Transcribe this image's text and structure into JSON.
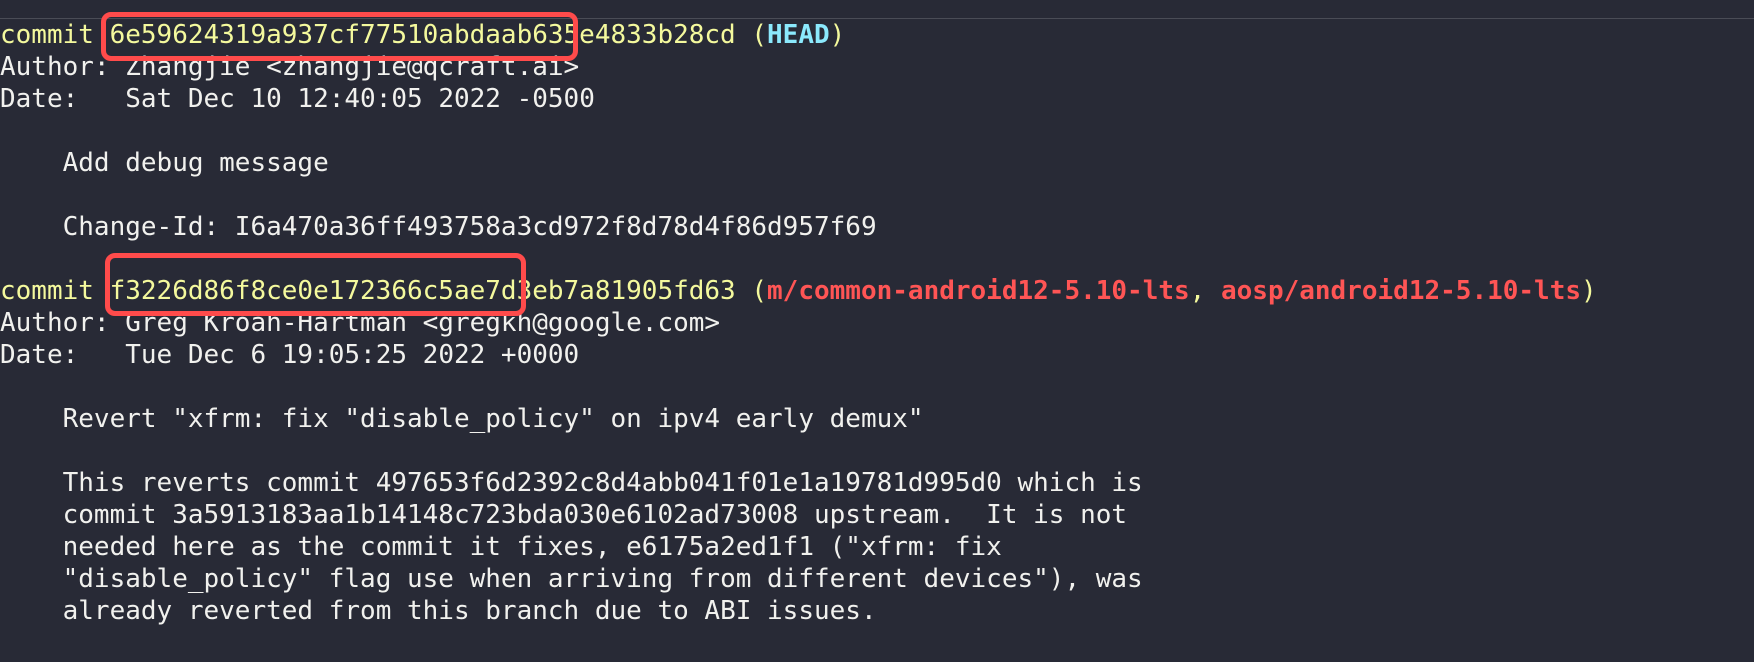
{
  "log": {
    "commit1": {
      "keyword": "commit",
      "hash": "6e59624319a937cf77510abdaab635e4833b28cd",
      "refs_open": "(",
      "ref_head": "HEAD",
      "refs_close": ")",
      "author_label": "Author:",
      "author_value": "Zhangjie <zhangjie@qcraft.ai>",
      "date_label": "Date:",
      "date_value": "Sat Dec 10 12:40:05 2022 -0500",
      "message_title": "Add debug message",
      "change_id": "Change-Id: I6a470a36ff493758a3cd972f8d78d4f86d957f69"
    },
    "commit2": {
      "keyword": "commit",
      "hash": "f3226d86f8ce0e172366c5ae7d3eb7a81905fd63",
      "refs_open": "(",
      "ref_branch1": "m/common-android12-5.10-lts",
      "refs_sep": ", ",
      "ref_branch2": "aosp/android12-5.10-lts",
      "refs_close": ")",
      "author_label": "Author:",
      "author_value": "Greg Kroah-Hartman <gregkh@google.com>",
      "date_label": "Date:",
      "date_value": "Tue Dec 6 19:05:25 2022 +0000",
      "message_title": "Revert \"xfrm: fix \"disable_policy\" on ipv4 early demux\"",
      "body_lines": [
        "This reverts commit 497653f6d2392c8d4abb041f01e1a19781d995d0 which is",
        "commit 3a5913183aa1b14148c723bda030e6102ad73008 upstream.  It is not",
        "needed here as the commit it fixes, e6175a2ed1f1 (\"xfrm: fix",
        "\"disable_policy\" flag use when arriving from different devices\"), was",
        "already reverted from this branch due to ABI issues."
      ]
    }
  },
  "colors": {
    "background": "#282a36",
    "commit_yellow": "#f4f99d",
    "head_cyan": "#8be9fd",
    "branch_red": "#ff5555",
    "highlight_box": "#ff4b4b"
  }
}
